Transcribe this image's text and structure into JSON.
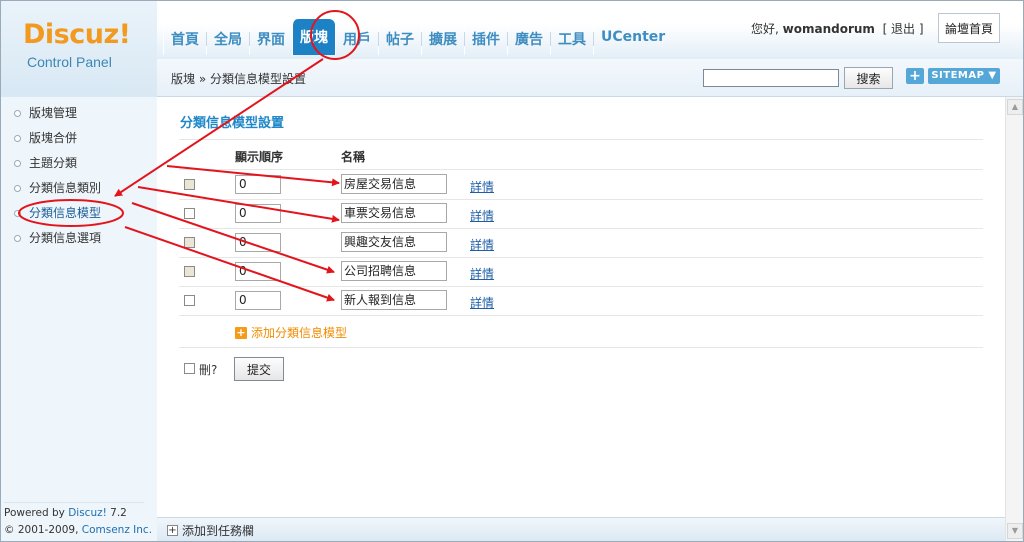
{
  "logo": {
    "brand": "Discuz!",
    "sub": "Control Panel"
  },
  "nav": {
    "tabs": [
      {
        "label": "首頁"
      },
      {
        "label": "全局"
      },
      {
        "label": "界面"
      },
      {
        "label": "版塊"
      },
      {
        "label": "用戶"
      },
      {
        "label": "帖子"
      },
      {
        "label": "擴展"
      },
      {
        "label": "插件"
      },
      {
        "label": "廣告"
      },
      {
        "label": "工具"
      },
      {
        "label": "UCenter"
      }
    ],
    "active": "版塊"
  },
  "user": {
    "greeting": "您好, ",
    "name": "womandorum",
    "logout": "[ 退出 ]",
    "home_button": "論壇首頁"
  },
  "toolbar": {
    "breadcrumb": "版塊 » 分類信息模型設置",
    "search_value": "",
    "search_button": "搜索",
    "plus_label": "+",
    "sitemap_label": "SITEMAP ▼"
  },
  "sidebar": {
    "items": [
      {
        "label": "版塊管理"
      },
      {
        "label": "版塊合併"
      },
      {
        "label": "主題分類"
      },
      {
        "label": "分類信息類別"
      },
      {
        "label": "分類信息模型"
      },
      {
        "label": "分類信息選項"
      }
    ],
    "current": "分類信息模型",
    "powered_prefix": "Powered by ",
    "powered_brand": "Discuz!",
    "powered_version": " 7.2",
    "copyright_prefix": "© 2001-2009, ",
    "copyright_company": "Comsenz Inc."
  },
  "main": {
    "title": "分類信息模型設置",
    "col_order": "顯示順序",
    "col_name": "名稱",
    "rows": [
      {
        "order": "0",
        "name": "房屋交易信息",
        "detail": "詳情",
        "checkbox_disabled": true
      },
      {
        "order": "0",
        "name": "車票交易信息",
        "detail": "詳情",
        "checkbox_disabled": false
      },
      {
        "order": "0",
        "name": "興趣交友信息",
        "detail": "詳情",
        "checkbox_disabled": true
      },
      {
        "order": "0",
        "name": "公司招聘信息",
        "detail": "詳情",
        "checkbox_disabled": true
      },
      {
        "order": "0",
        "name": "新人報到信息",
        "detail": "詳情",
        "checkbox_disabled": false
      }
    ],
    "add_label": "添加分類信息模型",
    "delete_label": "刪?",
    "submit_label": "提交"
  },
  "bottom": {
    "task_add": "添加到任務欄"
  },
  "colors": {
    "accent": "#2088c8",
    "nav_text": "#3f8ec2",
    "annotation": "#e3141b",
    "add_link": "#f08c00"
  }
}
